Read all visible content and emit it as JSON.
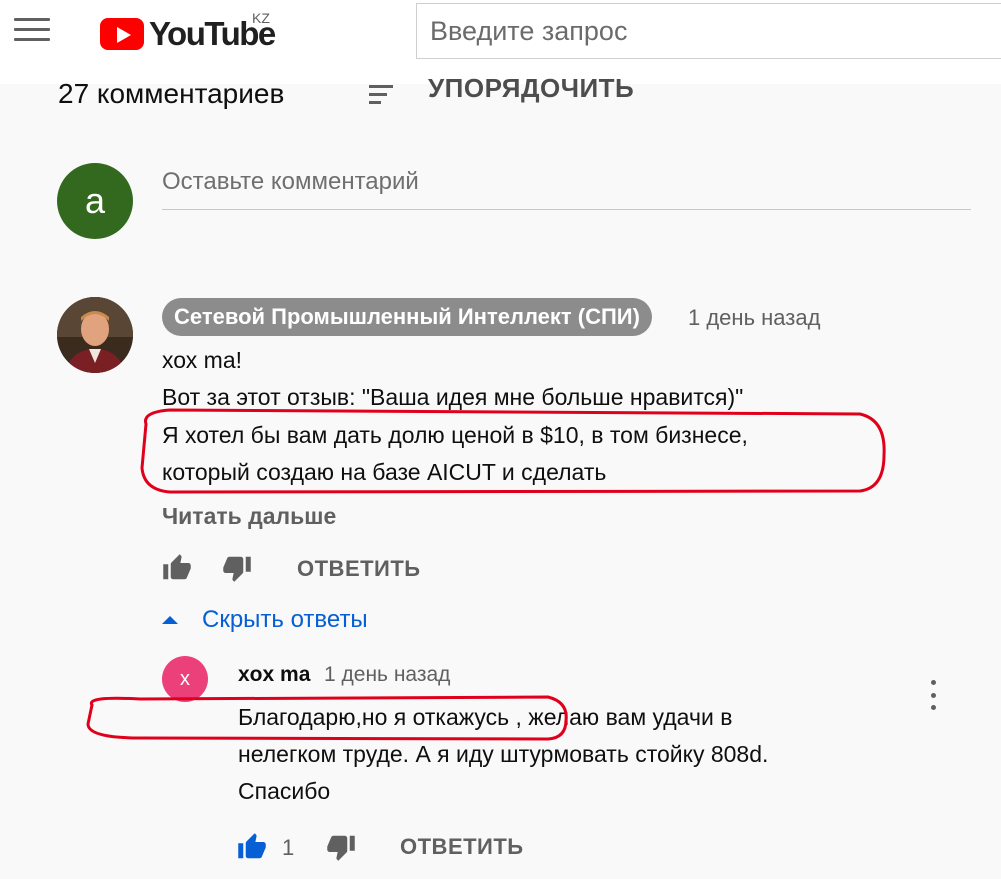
{
  "header": {
    "logo_text": "YouTube",
    "country": "KZ",
    "search_placeholder": "Введите запрос"
  },
  "comments_header": {
    "count": "27 комментариев",
    "sort_label": "УПОРЯДОЧИТЬ"
  },
  "add_comment": {
    "avatar_letter": "a",
    "placeholder": "Оставьте комментарий",
    "avatar_color": "#33691e"
  },
  "comment": {
    "author": "Сетевой Промышленный Интеллект (СПИ)",
    "time": "1 день назад",
    "lines": [
      "хох ma!",
      "Вот за этот отзыв: \"Ваша идея мне больше нравится)\"",
      "Я хотел бы вам дать долю ценой в $10, в том бизнесе,",
      "который создаю на базе AICUT и сделать"
    ],
    "read_more": "Читать дальше",
    "reply_button": "ОТВЕТИТЬ",
    "hide_replies": "Скрыть ответы"
  },
  "reply": {
    "avatar_letter": "x",
    "author": "xox ma",
    "time": "1 день назад",
    "lines": [
      "Благодарю,но я откажусь , желаю вам удачи в",
      "нелегком труде.  А я иду штурмовать стойку 808d.",
      "Спасибо"
    ],
    "like_count": "1",
    "reply_button": "ОТВЕТИТЬ",
    "avatar_color": "#ec407a"
  },
  "colors": {
    "annotation": "#e0001b",
    "link": "#065fd4",
    "liked": "#065fd4"
  }
}
